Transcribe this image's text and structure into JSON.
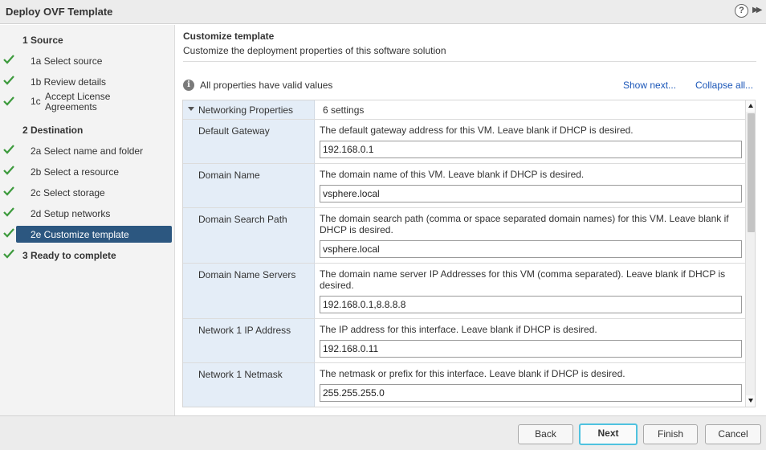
{
  "window": {
    "title": "Deploy OVF Template",
    "help_label": "?",
    "expand_label": "▶▶"
  },
  "sidebar": {
    "steps": [
      {
        "label": "1  Source",
        "kind": "group",
        "done": false
      },
      {
        "label": "1a  Select source",
        "kind": "sub",
        "done": true
      },
      {
        "label": "1b  Review details",
        "kind": "sub",
        "done": true
      },
      {
        "num": "1c",
        "label": "Accept License Agreements",
        "kind": "sub",
        "done": true
      },
      {
        "label": "2  Destination",
        "kind": "group",
        "done": false
      },
      {
        "label": "2a  Select name and folder",
        "kind": "sub",
        "done": true
      },
      {
        "label": "2b  Select a resource",
        "kind": "sub",
        "done": true
      },
      {
        "label": "2c  Select storage",
        "kind": "sub",
        "done": true
      },
      {
        "label": "2d  Setup networks",
        "kind": "sub",
        "done": true
      },
      {
        "label": "2e  Customize template",
        "kind": "sub",
        "done": true,
        "selected": true
      },
      {
        "label": "3  Ready to complete",
        "kind": "group",
        "done": true
      }
    ]
  },
  "main": {
    "title": "Customize template",
    "subtitle": "Customize the deployment properties of this software solution",
    "status_text": "All properties have valid values",
    "show_next": "Show next...",
    "collapse_all": "Collapse all...",
    "group": {
      "name": "Networking Properties",
      "count": "6 settings"
    },
    "properties": [
      {
        "name": "Default Gateway",
        "desc": "The default gateway address for this VM. Leave blank if DHCP is desired.",
        "value": "192.168.0.1"
      },
      {
        "name": "Domain Name",
        "desc": "The domain name of this VM. Leave blank if DHCP is desired.",
        "value": "vsphere.local"
      },
      {
        "name": "Domain Search Path",
        "desc": "The domain search path (comma or space separated domain names) for this VM. Leave blank if DHCP is desired.",
        "value": "vsphere.local"
      },
      {
        "name": "Domain Name Servers",
        "desc": "The domain name server IP Addresses for this VM (comma separated). Leave blank if DHCP is desired.",
        "value": "192.168.0.1,8.8.8.8"
      },
      {
        "name": "Network 1 IP Address",
        "desc": "The IP address for this interface. Leave blank if DHCP is desired.",
        "value": "192.168.0.11"
      },
      {
        "name": "Network 1 Netmask",
        "desc": "The netmask or prefix for this interface. Leave blank if DHCP is desired.",
        "value": "255.255.255.0"
      }
    ]
  },
  "footer": {
    "back": "Back",
    "next": "Next",
    "finish": "Finish",
    "cancel": "Cancel"
  },
  "colors": {
    "accent": "#2c5780",
    "check": "#3c9a3c",
    "link": "#1a56b8",
    "focus": "#4fc2df"
  }
}
